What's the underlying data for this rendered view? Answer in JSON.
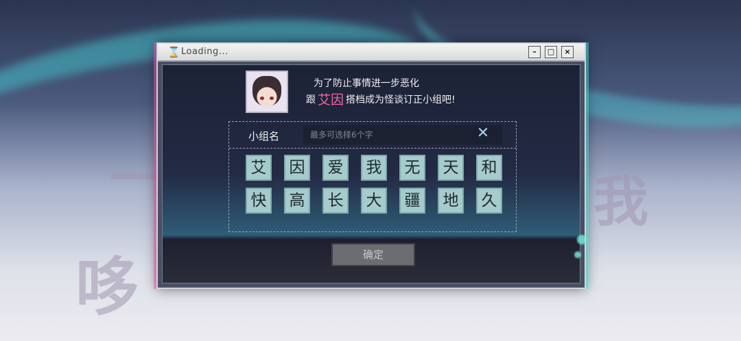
{
  "window": {
    "title": "Loading...",
    "hourglass_icon": "⌛",
    "minimize_label": "–",
    "maximize_label": "□",
    "close_label": "×"
  },
  "message": {
    "line1": "为了防止事情进一步恶化",
    "line2_prefix": "跟",
    "line2_name": "艾因",
    "line2_suffix": "搭档成为怪谈订正小组吧!"
  },
  "form": {
    "label": "小组名",
    "placeholder": "最多可选择6个字",
    "clear_icon": "✕"
  },
  "characters": [
    "艾",
    "因",
    "爱",
    "我",
    "无",
    "天",
    "和",
    "快",
    "高",
    "长",
    "大",
    "疆",
    "地",
    "久"
  ],
  "confirm_label": "确定",
  "background": {
    "big_chars": [
      "我",
      "哆",
      "一"
    ]
  },
  "colors": {
    "accent_pink": "#f066a8",
    "key_bg": "#a6cbcc",
    "clear_icon": "#a6d2ef"
  }
}
